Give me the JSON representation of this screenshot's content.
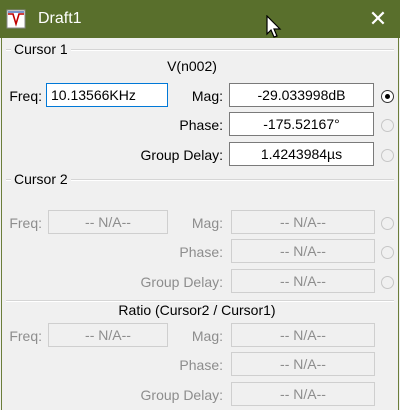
{
  "window": {
    "title": "Draft1",
    "close_glyph": "✕",
    "icon": "waveform-app-icon"
  },
  "cursor1": {
    "label": "Cursor 1",
    "node": "V(n002)",
    "freq_label": "Freq:",
    "freq_value": "10.13566KHz",
    "mag_label": "Mag:",
    "mag_value": "-29.033998dB",
    "phase_label": "Phase:",
    "phase_value": "-175.52167°",
    "group_delay_label": "Group Delay:",
    "group_delay_value": "1.4243984µs"
  },
  "cursor2": {
    "label": "Cursor 2",
    "freq_label": "Freq:",
    "freq_value": "-- N/A--",
    "mag_label": "Mag:",
    "mag_value": "-- N/A--",
    "phase_label": "Phase:",
    "phase_value": "-- N/A--",
    "group_delay_label": "Group Delay:",
    "group_delay_value": "-- N/A--"
  },
  "ratio": {
    "label": "Ratio (Cursor2 / Cursor1)",
    "freq_label": "Freq:",
    "freq_value": "-- N/A--",
    "mag_label": "Mag:",
    "mag_value": "-- N/A--",
    "phase_label": "Phase:",
    "phase_value": "-- N/A--",
    "group_delay_label": "Group Delay:",
    "group_delay_value": "-- N/A--"
  },
  "colors": {
    "titlebar": "#596f2c",
    "focus_border": "#0078d7",
    "disabled_text": "#8d8d8d"
  }
}
